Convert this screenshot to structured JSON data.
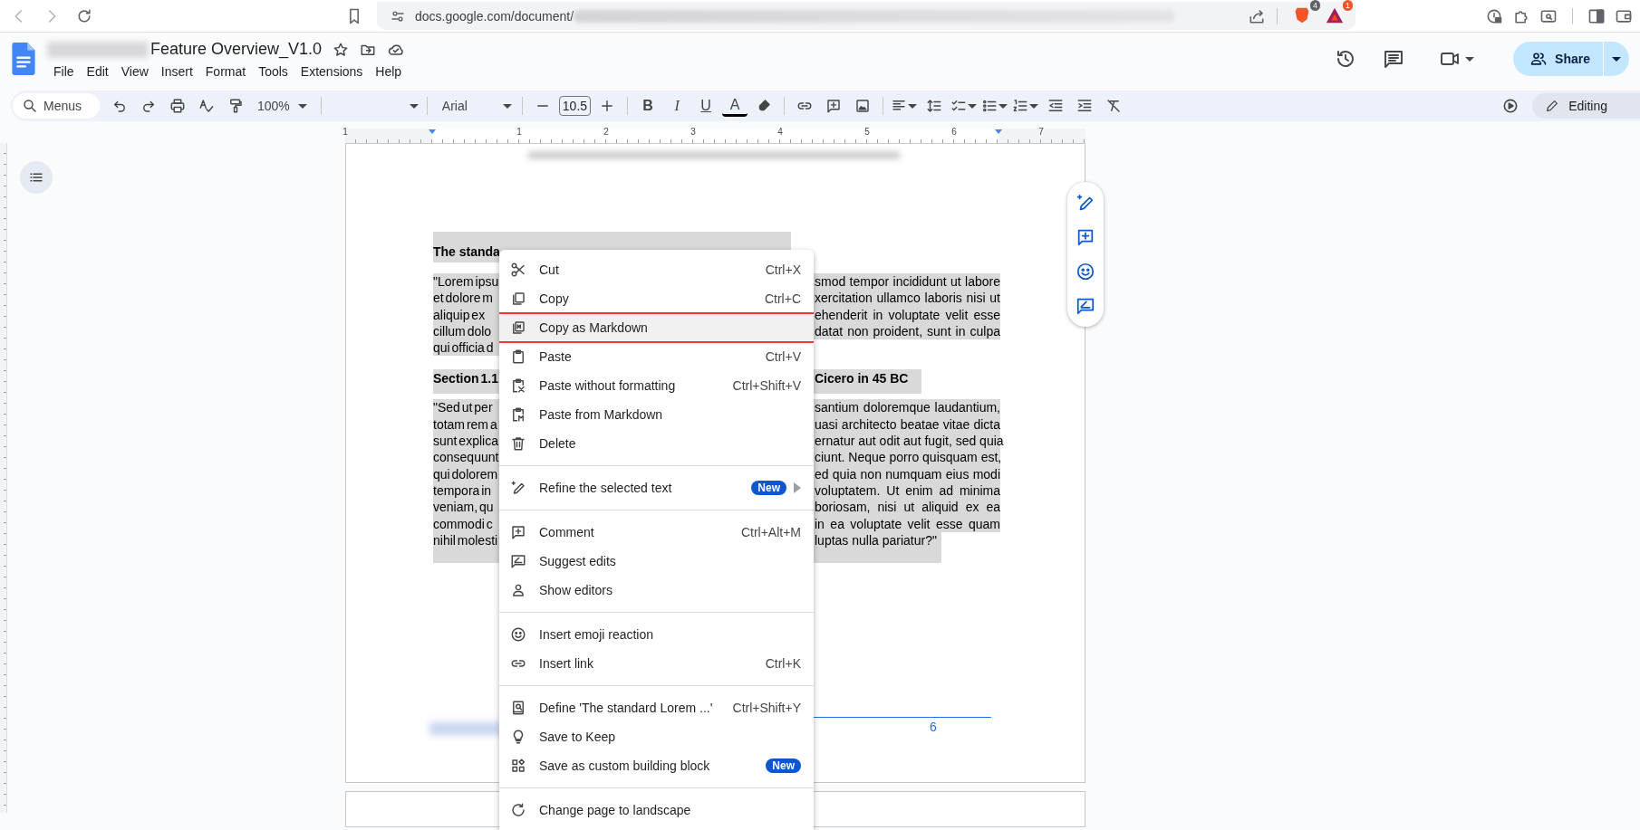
{
  "browser": {
    "url": "docs.google.com/document/",
    "badges": [
      "4",
      "1"
    ]
  },
  "document": {
    "title": "Feature Overview_V1.0",
    "menus": [
      "File",
      "Edit",
      "View",
      "Insert",
      "Format",
      "Tools",
      "Extensions",
      "Help"
    ],
    "share": "Share"
  },
  "toolbar": {
    "search": {
      "placeholder": "Menus"
    },
    "zoom": "100%",
    "font": "Arial",
    "font_size": "10.5",
    "format_buttons": [
      "B",
      "I",
      "U",
      "A"
    ],
    "mode": "Editing"
  },
  "ruler": {
    "labels": [
      "1",
      "1",
      "2",
      "3",
      "4",
      "5",
      "6",
      "7"
    ]
  },
  "page": {
    "heading_1": "The standa",
    "paragraph_1": [
      {
        "left": "\"Lorem ipsu",
        "right": "smod tempor incididunt ut labore"
      },
      {
        "left": "et dolore m",
        "right": "xercitation ullamco laboris nisi ut"
      },
      {
        "left": "aliquip ex",
        "right": "ehenderit in voluptate velit esse"
      },
      {
        "left": "cillum dolo",
        "right": "datat non proident, sunt in culpa"
      },
      {
        "left": "qui officia d"
      }
    ],
    "heading_2": {
      "left": "Section 1.1",
      "right": "Cicero in 45 BC"
    },
    "paragraph_2": [
      {
        "left": "\"Sed ut per",
        "right": "santium doloremque laudantium,"
      },
      {
        "left": "totam rem a",
        "right": "uasi architecto beatae vitae dicta"
      },
      {
        "left": "sunt explica",
        "right": "ernatur aut odit aut fugit, sed quia"
      },
      {
        "left": "consequunt",
        "right": "ciunt. Neque porro quisquam est,"
      },
      {
        "left": "qui dolorem",
        "right": "ed quia non numquam eius modi"
      },
      {
        "left": "tempora in",
        "right": "voluptatem. Ut enim ad minima"
      },
      {
        "left": "veniam, qu",
        "right": "boriosam, nisi ut aliquid ex ea"
      },
      {
        "left": "commodi c",
        "right": "in ea voluptate velit esse quam"
      },
      {
        "left": "nihil molesti",
        "right": "luptas nulla pariatur?\""
      }
    ],
    "page_number": "6"
  },
  "context_menu": {
    "groups": [
      [
        {
          "label": "Cut",
          "shortcut": "Ctrl+X",
          "submenu": false,
          "selected": false
        },
        {
          "label": "Copy",
          "shortcut": "Ctrl+C",
          "submenu": false,
          "selected": false
        },
        {
          "label": "Copy as Markdown",
          "submenu": false,
          "selected": true
        },
        {
          "label": "Paste",
          "shortcut": "Ctrl+V",
          "submenu": false,
          "selected": false
        },
        {
          "label": "Paste without formatting",
          "shortcut": "Ctrl+Shift+V",
          "submenu": false,
          "selected": false
        },
        {
          "label": "Paste from Markdown",
          "submenu": false,
          "selected": false
        },
        {
          "label": "Delete",
          "submenu": false,
          "selected": false
        }
      ],
      [
        {
          "label": "Refine the selected text",
          "badge": "New",
          "submenu": true,
          "selected": false
        }
      ],
      [
        {
          "label": "Comment",
          "shortcut": "Ctrl+Alt+M",
          "submenu": false,
          "selected": false
        },
        {
          "label": "Suggest edits",
          "submenu": false,
          "selected": false
        },
        {
          "label": "Show editors",
          "submenu": false,
          "selected": false
        }
      ],
      [
        {
          "label": "Insert emoji reaction",
          "submenu": false,
          "selected": false
        },
        {
          "label": "Insert link",
          "shortcut": "Ctrl+K",
          "submenu": false,
          "selected": false
        }
      ],
      [
        {
          "label": "Define 'The standard Lorem ...'",
          "shortcut": "Ctrl+Shift+Y",
          "submenu": false,
          "selected": false
        },
        {
          "label": "Save to Keep",
          "submenu": false,
          "selected": false
        },
        {
          "label": "Save as custom building block",
          "badge": "New",
          "submenu": false,
          "selected": false
        }
      ],
      [
        {
          "label": "Change page to landscape",
          "submenu": false,
          "selected": false
        }
      ]
    ]
  }
}
